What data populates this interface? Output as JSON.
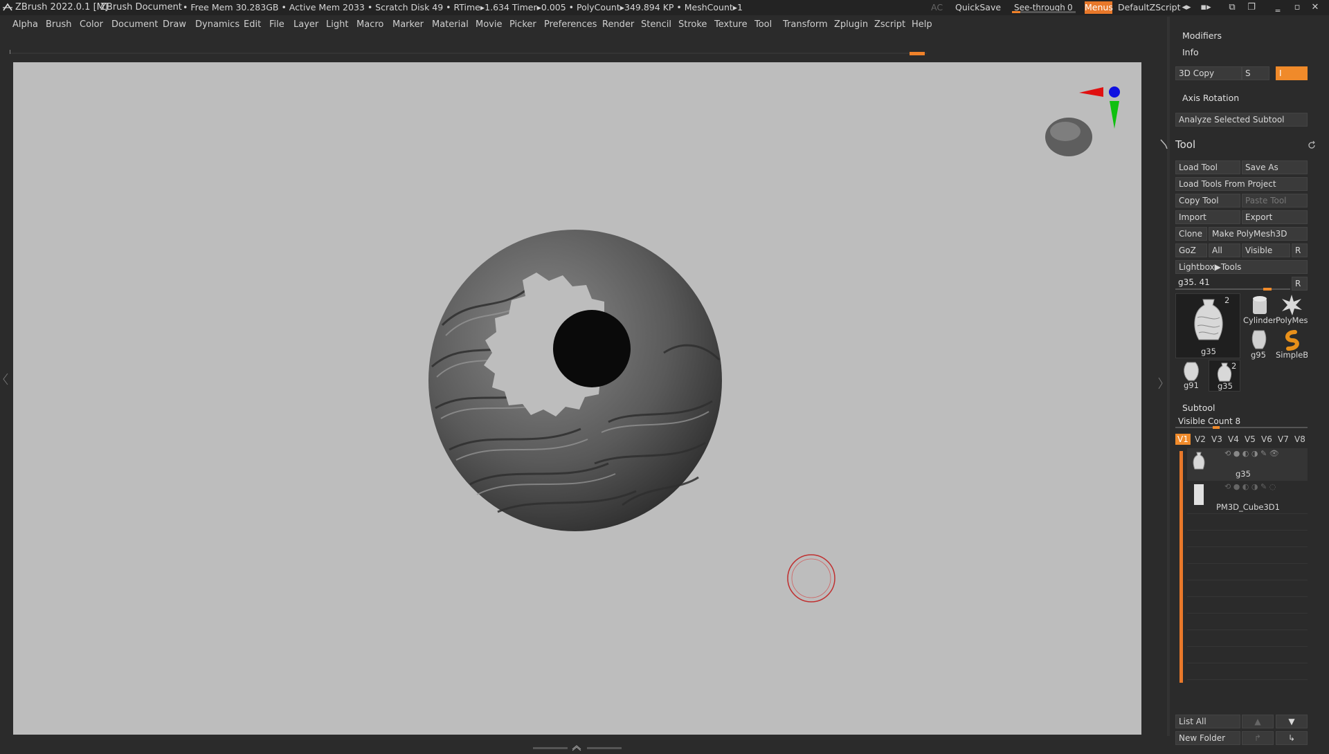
{
  "titlebar": {
    "app_title": "ZBrush 2022.0.1 [M]",
    "document": "ZBrush Document",
    "stats": "• Free Mem 30.283GB • Active Mem 2033 • Scratch Disk 49 •  RTime▸1.634 Timer▸0.005 • PolyCount▸349.894 KP  • MeshCount▸1",
    "ac": "AC",
    "quicksave": "QuickSave",
    "seethrough_label": "See-through",
    "seethrough_value": "0",
    "menus": "Menus",
    "script": "DefaultZScript"
  },
  "menubar": [
    "Alpha",
    "Brush",
    "Color",
    "Document",
    "Draw",
    "Dynamics",
    "Edit",
    "File",
    "Layer",
    "Light",
    "Macro",
    "Marker",
    "Material",
    "Movie",
    "Picker",
    "Preferences",
    "Render",
    "Stencil",
    "Stroke",
    "Texture",
    "Tool",
    "Transform",
    "Zplugin",
    "Zscript",
    "Help"
  ],
  "panel": {
    "modifiers": "Modifiers",
    "info": "Info",
    "copy3d": "3D Copy",
    "copy3d_s": "S",
    "copy3d_field": "I",
    "axis_rotation": "Axis Rotation",
    "analyze": "Analyze Selected Subtool",
    "tool_title": "Tool",
    "load_tool": "Load Tool",
    "save_as": "Save As",
    "load_from_project": "Load Tools From Project",
    "copy_tool": "Copy Tool",
    "paste_tool": "Paste Tool",
    "import": "Import",
    "export": "Export",
    "clone": "Clone",
    "make_polymesh": "Make PolyMesh3D",
    "goz": "GoZ",
    "all": "All",
    "visible": "Visible",
    "r": "R",
    "lightbox_tools": "Lightbox▶Tools",
    "current_tool": "g35. 41",
    "current_tool_r": "R",
    "thumbs": {
      "main_name": "g35",
      "main_count": "2",
      "cylinder": "Cylinder",
      "polymesh": "PolyMes",
      "g95": "g95",
      "simpleb": "SimpleB",
      "g91": "g91",
      "g35b": "g35",
      "g35b_count": "2"
    },
    "subtool_title": "Subtool",
    "visible_count": "Visible Count 8",
    "vtabs": [
      "V1",
      "V2",
      "V3",
      "V4",
      "V5",
      "V6",
      "V7",
      "V8"
    ],
    "subtools": [
      "g35",
      "PM3D_Cube3D1"
    ],
    "list_all": "List All",
    "new_folder": "New Folder"
  },
  "colors": {
    "accent": "#f08a2a",
    "viewport": "#bdbdbd",
    "panel": "#2b2b2b"
  }
}
